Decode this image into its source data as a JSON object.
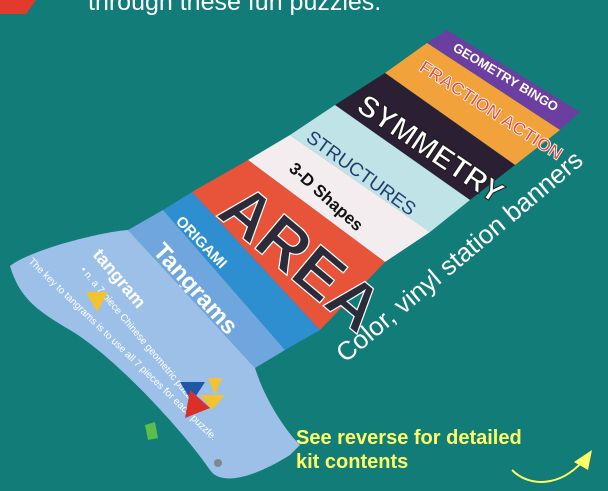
{
  "header": {
    "text": "through these fun puzzles."
  },
  "banners": [
    {
      "title": "GEOMETRY BINGO",
      "color": "#6A3FA0"
    },
    {
      "title": "FRACTION ACTION",
      "color": "#F2A23A"
    },
    {
      "title": "SYMMETRY",
      "color": "#2B1F33"
    },
    {
      "title": "STRUCTURES",
      "color": "#BFE3E6"
    },
    {
      "title": "3-D Shapes",
      "color": "#F3EDEF"
    },
    {
      "title": "AREA",
      "color": "#E8543A"
    },
    {
      "title": "ORIGAMI",
      "color": "#2E8FD0"
    },
    {
      "title": "Tangrams",
      "color": "#6FA6DE"
    }
  ],
  "tangram_banner": {
    "heading": "tangram",
    "definition": "• n. a 7-piece Chinese geometric puzzle",
    "body": "The key to tangrams is to use all 7 pieces for each puzzle."
  },
  "caption": "Color, vinyl station banners",
  "note": {
    "line1": "See reverse for detailed",
    "line2": "kit contents"
  }
}
